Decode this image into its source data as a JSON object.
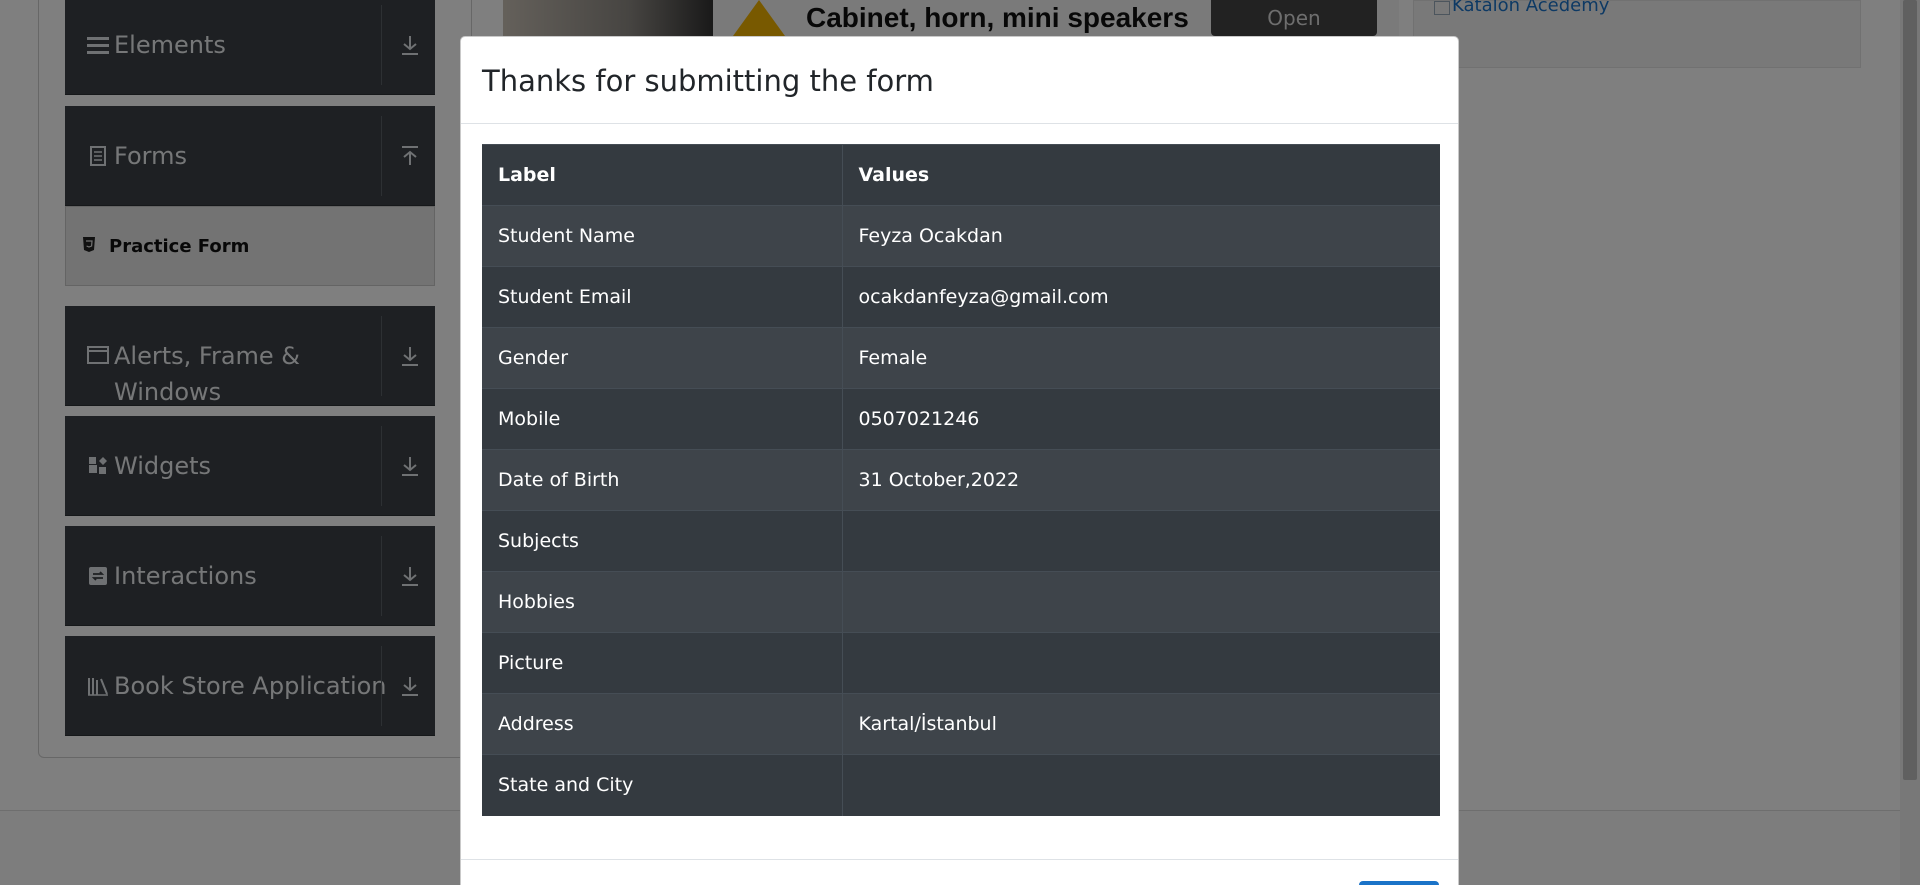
{
  "sidebar": {
    "groups": [
      {
        "label": "Elements",
        "icon": "hamburger-icon"
      },
      {
        "label": "Forms",
        "icon": "document-icon"
      },
      {
        "label": "Alerts, Frame & Windows",
        "icon": "window-icon"
      },
      {
        "label": "Widgets",
        "icon": "widgets-icon"
      },
      {
        "label": "Interactions",
        "icon": "interactions-icon"
      },
      {
        "label": "Book Store Application",
        "icon": "books-icon"
      }
    ],
    "active_item": {
      "label": "Practice Form",
      "icon": "html5-icon"
    }
  },
  "ad": {
    "text": "Cabinet, horn, mini speakers",
    "button": "Open"
  },
  "katalon": {
    "alt_text": "Katalon Acedemy"
  },
  "modal": {
    "title": "Thanks for submitting the form",
    "headers": [
      "Label",
      "Values"
    ],
    "rows": [
      {
        "label": "Student Name",
        "value": "Feyza Ocakdan"
      },
      {
        "label": "Student Email",
        "value": "ocakdanfeyza@gmail.com"
      },
      {
        "label": "Gender",
        "value": "Female"
      },
      {
        "label": "Mobile",
        "value": "0507021246"
      },
      {
        "label": "Date of Birth",
        "value": "31 October,2022"
      },
      {
        "label": "Subjects",
        "value": ""
      },
      {
        "label": "Hobbies",
        "value": ""
      },
      {
        "label": "Picture",
        "value": ""
      },
      {
        "label": "Address",
        "value": "Kartal/İstanbul"
      },
      {
        "label": "State and City",
        "value": ""
      }
    ]
  },
  "colors": {
    "sidebar_bg": "#3c4146",
    "table_dark": "#343a40",
    "table_stripe": "#3e444a",
    "accent_blue": "#1a73c8",
    "overlay": "rgba(0,0,0,0.5)"
  }
}
